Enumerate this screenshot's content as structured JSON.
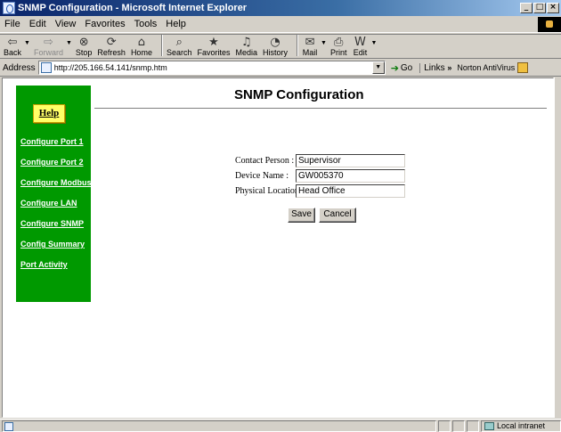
{
  "window": {
    "title": "SNMP Configuration - Microsoft Internet Explorer",
    "controls": [
      "_",
      "□",
      "×"
    ]
  },
  "menu": [
    "File",
    "Edit",
    "View",
    "Favorites",
    "Tools",
    "Help"
  ],
  "toolbar": {
    "buttons": [
      {
        "label": "Back",
        "icon": "back-arrow-icon",
        "glyph": "⇦"
      },
      {
        "label": "Forward",
        "icon": "forward-arrow-icon",
        "glyph": "⇨"
      },
      {
        "label": "Stop",
        "icon": "stop-icon",
        "glyph": "⊗"
      },
      {
        "label": "Refresh",
        "icon": "refresh-icon",
        "glyph": "⟳"
      },
      {
        "label": "Home",
        "icon": "home-icon",
        "glyph": "⌂"
      },
      {
        "label": "Search",
        "icon": "search-icon",
        "glyph": "⌕"
      },
      {
        "label": "Favorites",
        "icon": "favorites-icon",
        "glyph": "★"
      },
      {
        "label": "Media",
        "icon": "media-icon",
        "glyph": "♫"
      },
      {
        "label": "History",
        "icon": "history-icon",
        "glyph": "◔"
      },
      {
        "label": "Mail",
        "icon": "mail-icon",
        "glyph": "✉"
      },
      {
        "label": "Print",
        "icon": "print-icon",
        "glyph": "⎙"
      },
      {
        "label": "Edit",
        "icon": "edit-icon",
        "glyph": "W"
      }
    ]
  },
  "address": {
    "label": "Address",
    "url": "http://205.166.54.141/snmp.htm",
    "go_label": "Go",
    "links_label": "Links",
    "norton_label": "Norton AntiVirus"
  },
  "sidebar": {
    "help_label": "Help",
    "links": [
      "Configure Port 1",
      "Configure Port 2",
      "Configure Modbus",
      "Configure LAN",
      "Configure SNMP",
      "Config Summary",
      "Port Activity"
    ]
  },
  "page": {
    "title": "SNMP Configuration"
  },
  "form": {
    "contact_label": "Contact Person :",
    "contact_value": "Supervisor",
    "device_label": "Device Name :",
    "device_value": "GW005370",
    "location_label": "Physical Location :",
    "location_value": "Head Office",
    "save_label": "Save",
    "cancel_label": "Cancel"
  },
  "status": {
    "zone": "Local intranet"
  },
  "colors": {
    "sidebar": "#009900",
    "help_button": "#ffff66",
    "titlebar": "#0a246a"
  }
}
